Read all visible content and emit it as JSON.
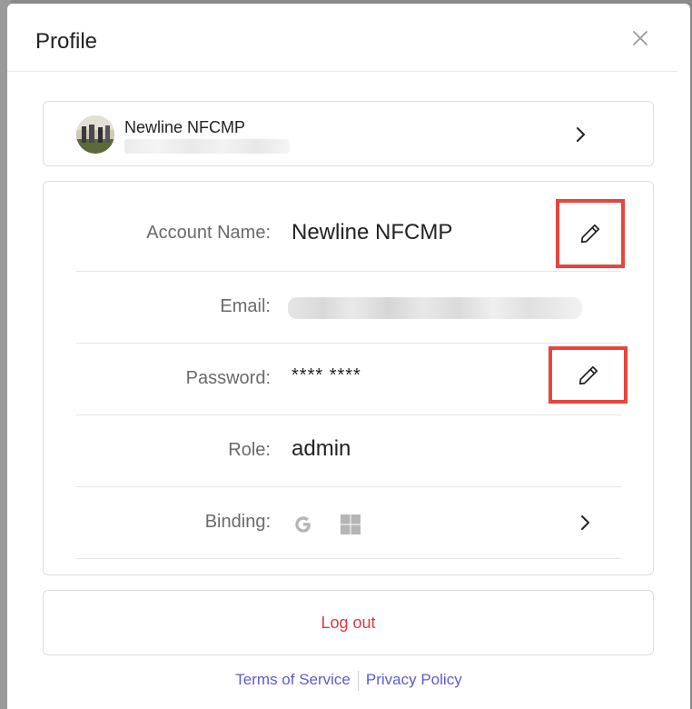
{
  "modal": {
    "title": "Profile"
  },
  "user_card": {
    "name": "Newline NFCMP"
  },
  "details": {
    "account_name": {
      "label": "Account Name:",
      "value": "Newline NFCMP"
    },
    "email": {
      "label": "Email:"
    },
    "password": {
      "label": "Password:",
      "value": "**** ****"
    },
    "role": {
      "label": "Role:",
      "value": "admin"
    },
    "binding": {
      "label": "Binding:",
      "providers": [
        "google-icon",
        "windows-icon"
      ]
    }
  },
  "logout": {
    "label": "Log out"
  },
  "footer": {
    "terms": "Terms of Service",
    "privacy": "Privacy Policy"
  },
  "colors": {
    "highlight_border": "#e8453c",
    "logout_text": "#e0393e",
    "link": "#5b5bd6"
  },
  "icons": {
    "close": "close-icon",
    "chevron": "chevron-right-icon",
    "edit": "pencil-icon"
  }
}
